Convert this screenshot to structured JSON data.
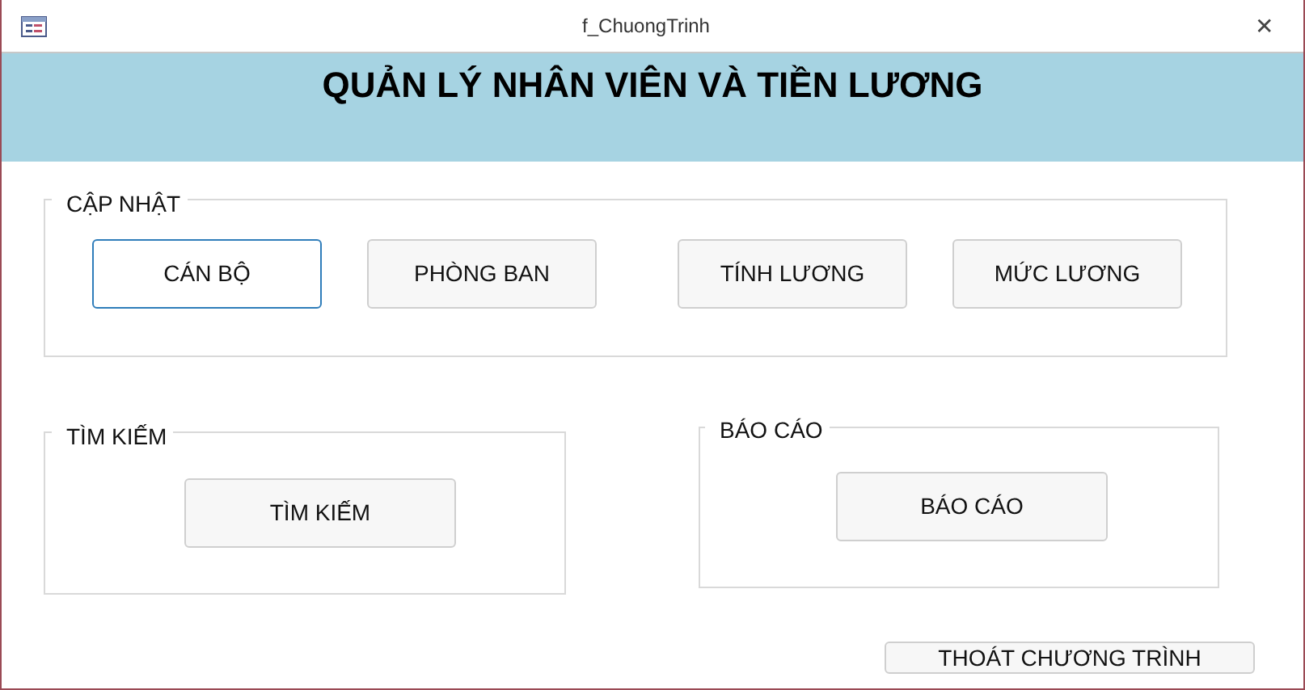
{
  "window": {
    "title": "f_ChuongTrinh",
    "close": "✕"
  },
  "header": {
    "title": "QUẢN LÝ NHÂN VIÊN VÀ TIỀN LƯƠNG"
  },
  "groups": [
    {
      "legend": "CẬP NHẬT",
      "buttons": [
        {
          "label": "CÁN BỘ",
          "focused": true
        },
        {
          "label": "PHÒNG BAN",
          "focused": false
        },
        {
          "label": "TÍNH LƯƠNG",
          "focused": false
        },
        {
          "label": "MỨC LƯƠNG",
          "focused": false
        }
      ]
    },
    {
      "legend": "TÌM KIẾM",
      "buttons": [
        {
          "label": "TÌM KIẾM",
          "focused": false
        }
      ]
    },
    {
      "legend": "BÁO CÁO",
      "buttons": [
        {
          "label": "BÁO CÁO",
          "focused": false
        }
      ]
    }
  ],
  "exit_button": {
    "label": "THOÁT CHƯƠNG TRÌNH"
  }
}
